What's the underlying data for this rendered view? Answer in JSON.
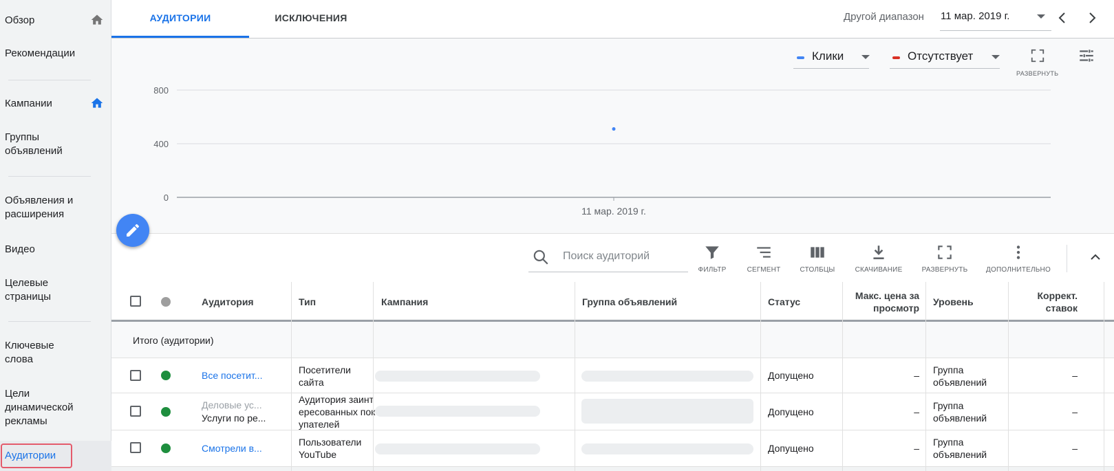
{
  "sidebar": {
    "items": [
      {
        "label": "Обзор"
      },
      {
        "label": "Рекомендации"
      },
      {
        "label": "Кампании"
      },
      {
        "label": "Группы объявлений"
      },
      {
        "label": "Объявления и расширения"
      },
      {
        "label": "Видео"
      },
      {
        "label": "Целевые страницы"
      },
      {
        "label": "Ключевые слова"
      },
      {
        "label": "Цели динамической рекламы"
      },
      {
        "label": "Аудитории"
      }
    ],
    "active": "Аудитории",
    "colors": {
      "active_text": "#1a73e8",
      "highlight_border": "#e45a6b",
      "home_icon_blue": "#1a73e8",
      "home_icon_grey": "#757575"
    }
  },
  "tabs": [
    {
      "label": "АУДИТОРИИ",
      "active": true
    },
    {
      "label": "ИСКЛЮЧЕНИЯ",
      "active": false
    }
  ],
  "date_range": {
    "label": "Другой диапазон",
    "value": "11 мар. 2019 г."
  },
  "chart_controls": {
    "metric1": {
      "label": "Клики",
      "color": "#4285f4"
    },
    "metric2": {
      "label": "Отсутствует",
      "color": "#d93025"
    },
    "expand_label": "РАЗВЕРНУТЬ"
  },
  "chart_data": {
    "type": "scatter",
    "x": [
      "11 мар. 2019 г."
    ],
    "series": [
      {
        "values": [
          510
        ]
      }
    ],
    "y_ticks": [
      0,
      400,
      800
    ],
    "ylim": [
      0,
      800
    ],
    "grid": true
  },
  "toolbar": {
    "search_placeholder": "Поиск аудиторий",
    "filter": "ФИЛЬТР",
    "segment": "СЕГМЕНТ",
    "columns": "СТОЛБЦЫ",
    "download": "СКАЧИВАНИЕ",
    "expand": "РАЗВЕРНУТЬ",
    "more": "ДОПОЛНИТЕЛЬНО"
  },
  "table": {
    "headers": {
      "audience": "Аудитория",
      "type": "Тип",
      "campaign": "Кампания",
      "ad_group": "Группа объявлений",
      "status": "Статус",
      "max_cpv": "Макс. цена за просмотр",
      "level": "Уровень",
      "bid_adj": "Коррект. ставок"
    },
    "total_label": "Итого (аудитории)",
    "rows": [
      {
        "audience": "Все посетит...",
        "audience_sub": "",
        "type": "Посетители сайта",
        "status": "Допущено",
        "max_cpv": "–",
        "level": "Группа объявлений",
        "bid_adj": "–"
      },
      {
        "audience": "Деловые ус...",
        "audience_sub": "Услуги по ре...",
        "type": "Аудитория заинтересованных покупателей",
        "status": "Допущено",
        "max_cpv": "–",
        "level": "Группа объявлений",
        "bid_adj": "–"
      },
      {
        "audience": "Смотрели в...",
        "audience_sub": "",
        "type": "Пользователи YouTube",
        "status": "Допущено",
        "max_cpv": "–",
        "level": "Группа объявлений",
        "bid_adj": "–"
      }
    ],
    "status_color": "#1e8e3e"
  }
}
